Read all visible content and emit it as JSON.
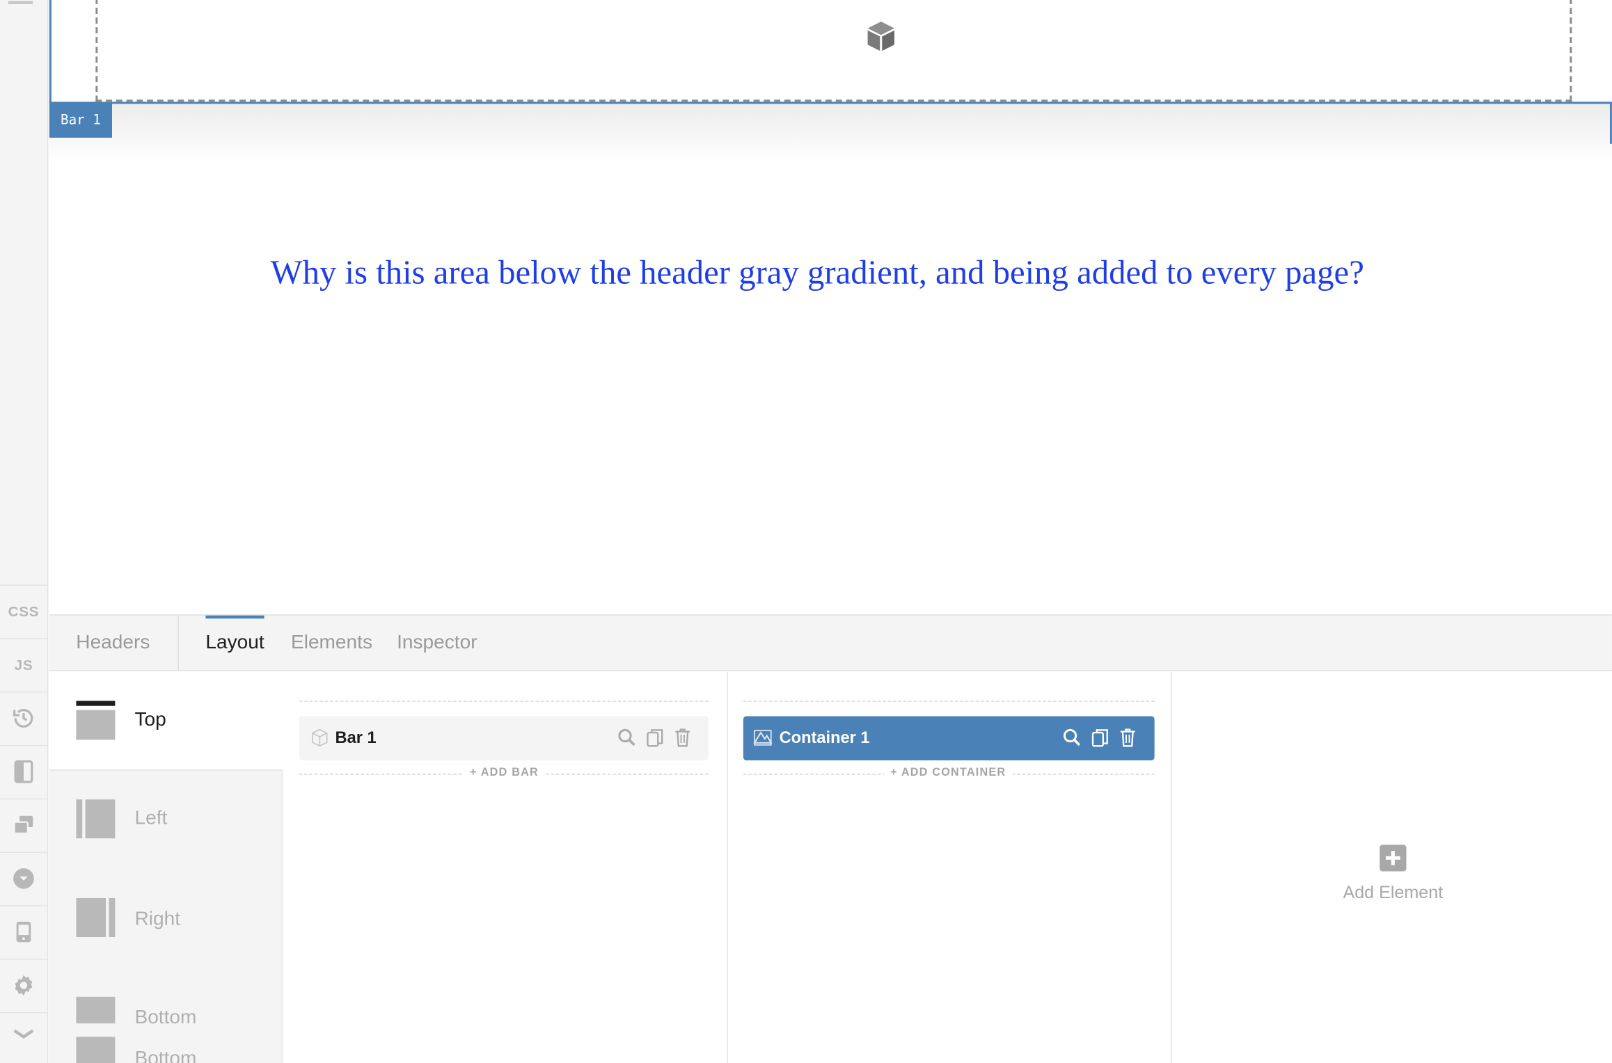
{
  "rail": {
    "css_label": "CSS",
    "js_label": "JS",
    "icons": [
      "menu-icon",
      "history-icon",
      "sidebar-icon",
      "layers-icon",
      "dropdown-icon",
      "mobile-icon",
      "gear-icon",
      "collapse-icon"
    ]
  },
  "canvas": {
    "bar_tag": "Bar 1",
    "question_text": "Why is this area below the header gray gradient, and being added to every page?"
  },
  "tabs": {
    "headers": "Headers",
    "layout": "Layout",
    "elements": "Elements",
    "inspector": "Inspector",
    "active": "Layout"
  },
  "positions": {
    "top": "Top",
    "left": "Left",
    "right": "Right",
    "bottom": "Bottom",
    "bottom2": "Bottom"
  },
  "bars": {
    "item_label": "Bar 1",
    "add_label": "+ ADD BAR"
  },
  "containers": {
    "item_label": "Container 1",
    "add_label": "+ ADD CONTAINER"
  },
  "elements_col": {
    "add_label": "Add Element"
  },
  "colors": {
    "accent": "#4a82b8",
    "question": "#1f3ee6"
  }
}
